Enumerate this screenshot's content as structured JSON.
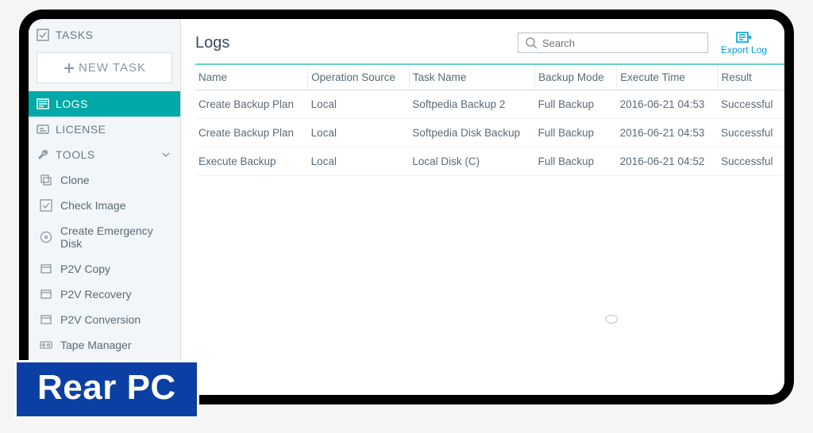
{
  "sidebar": {
    "tasks_label": "TASKS",
    "new_task_label": "NEW TASK",
    "logs_label": "LOGS",
    "license_label": "LICENSE",
    "tools_label": "TOOLS",
    "tools_items": [
      {
        "label": "Clone",
        "icon": "clone"
      },
      {
        "label": "Check Image",
        "icon": "check"
      },
      {
        "label": "Create Emergency Disk",
        "icon": "disk"
      },
      {
        "label": "P2V Copy",
        "icon": "p2v"
      },
      {
        "label": "P2V Recovery",
        "icon": "p2v"
      },
      {
        "label": "P2V Conversion",
        "icon": "p2v"
      },
      {
        "label": "Tape Manager",
        "icon": "tape"
      }
    ]
  },
  "main": {
    "title": "Logs",
    "search_placeholder": "Search",
    "export_label": "Export Log",
    "columns": [
      "Name",
      "Operation Source",
      "Task Name",
      "Backup Mode",
      "Execute Time",
      "Result"
    ],
    "rows": [
      {
        "name": "Create Backup Plan",
        "source": "Local",
        "task": "Softpedia Backup 2",
        "mode": "Full Backup",
        "time": "2016-06-21 04:53",
        "result": "Successful"
      },
      {
        "name": "Create Backup Plan",
        "source": "Local",
        "task": "Softpedia Disk Backup",
        "mode": "Full Backup",
        "time": "2016-06-21 04:53",
        "result": "Successful"
      },
      {
        "name": "Execute Backup",
        "source": "Local",
        "task": "Local Disk (C)",
        "mode": "Full Backup",
        "time": "2016-06-21 04:52",
        "result": "Successful"
      }
    ]
  },
  "watermark": "Rear PC",
  "colors": {
    "accent": "#00a8a8",
    "link": "#009fdc",
    "badge_bg": "#0b3fa3"
  }
}
